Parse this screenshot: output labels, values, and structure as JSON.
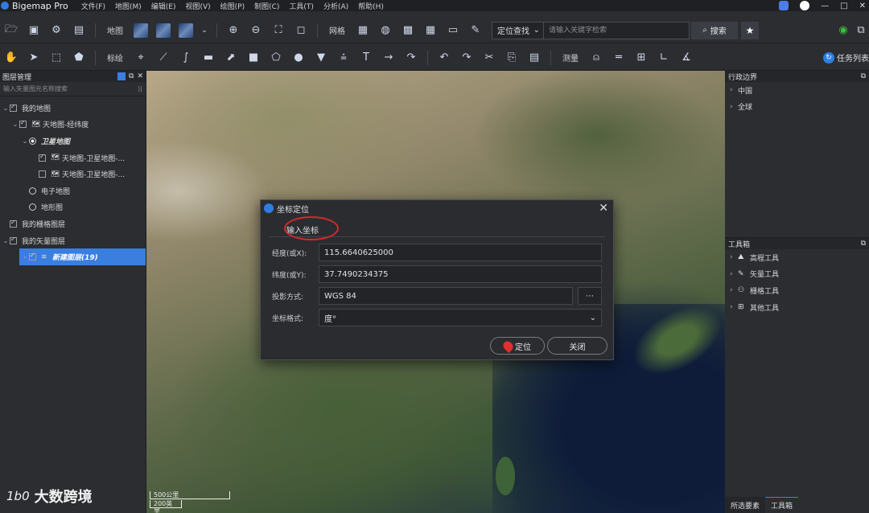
{
  "app": {
    "title": "Bigemap Pro",
    "menu": [
      "文件(F)",
      "地图(M)",
      "编辑(E)",
      "视图(V)",
      "绘图(P)",
      "制图(C)",
      "工具(T)",
      "分析(A)",
      "帮助(H)"
    ],
    "window_controls": [
      "—",
      "□",
      "✕"
    ]
  },
  "toolbar1": {
    "map_label": "地图",
    "grid_label": "网格",
    "search_mode": "定位查找",
    "search_placeholder": "请输入关键字检索",
    "search_button": "搜索"
  },
  "toolbar2": {
    "annotate_label": "标绘",
    "measure_label": "测量",
    "task_list": "任务列表"
  },
  "left_panel": {
    "title": "图层管理",
    "filter_placeholder": "输入矢量图元名称搜索",
    "nodes": [
      {
        "label": "我的地图",
        "arrow": "⌄",
        "kind": "checkbox",
        "checked": true,
        "indent": 0,
        "style": "normal"
      },
      {
        "label": "天地图-经纬度",
        "arrow": "⌄",
        "kind": "checkbox",
        "checked": true,
        "indent": 1,
        "style": "normal"
      },
      {
        "label": "卫星地图",
        "arrow": "⌄",
        "kind": "radio",
        "checked": true,
        "indent": 2,
        "style": "italic"
      },
      {
        "label": "天地图-卫星地图-...",
        "arrow": "",
        "kind": "checkbox",
        "checked": true,
        "indent": 3,
        "style": "normal"
      },
      {
        "label": "天地图-卫星地图-...",
        "arrow": "",
        "kind": "checkbox",
        "checked": false,
        "indent": 3,
        "style": "normal"
      },
      {
        "label": "电子地图",
        "arrow": "",
        "kind": "radio",
        "checked": false,
        "indent": 2,
        "style": "normal"
      },
      {
        "label": "地形图",
        "arrow": "",
        "kind": "radio",
        "checked": false,
        "indent": 2,
        "style": "normal"
      },
      {
        "label": "我的栅格图层",
        "arrow": "",
        "kind": "checkbox",
        "checked": true,
        "indent": 0,
        "style": "normal"
      },
      {
        "label": "我的矢量图层",
        "arrow": "⌄",
        "kind": "checkbox",
        "checked": true,
        "indent": 0,
        "style": "normal"
      },
      {
        "label": "新建图层(19)",
        "arrow": "›",
        "kind": "checkbox",
        "checked": true,
        "indent": 1,
        "style": "italic-selected"
      }
    ]
  },
  "map": {
    "scale_top": "500公里",
    "scale_bottom": "200英里"
  },
  "dialog": {
    "title": "坐标定位",
    "tab": "输入坐标",
    "fields": {
      "lon_label": "经度(或X):",
      "lon_value": "115.6640625000",
      "lat_label": "纬度(或Y):",
      "lat_value": "37.7490234375",
      "proj_label": "投影方式:",
      "proj_value": "WGS 84",
      "format_label": "坐标格式:",
      "format_value": "度°"
    },
    "locate_button": "定位",
    "close_button": "关闭"
  },
  "right_panel": {
    "admin_title": "行政边界",
    "admin_items": [
      "中国",
      "全球"
    ],
    "toolbox_title": "工具箱",
    "toolbox_items": [
      "高程工具",
      "矢量工具",
      "栅格工具",
      "其他工具"
    ],
    "bottom_tabs": [
      "所选要素",
      "工具箱"
    ]
  },
  "watermark": {
    "text": "大数跨境",
    "mark": "1b0"
  },
  "colors": {
    "accent": "#3a7ee0",
    "highlight_circle": "#d22a2a",
    "panel_bg": "#2b2d31"
  }
}
